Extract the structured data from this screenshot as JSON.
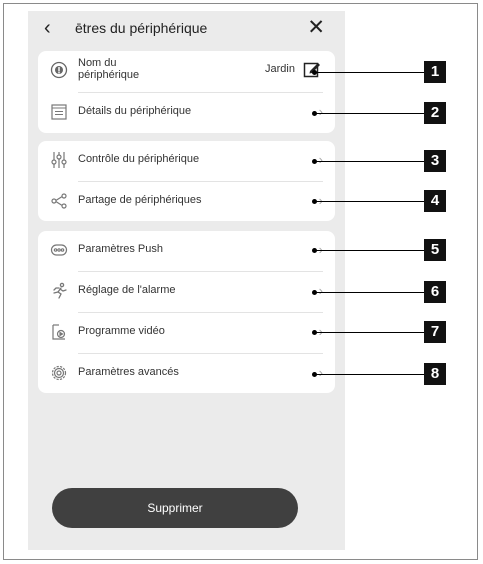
{
  "header": {
    "back_icon": "chevron-left-icon",
    "title": "ētres du périphérique",
    "close_icon": "close-icon"
  },
  "card1": {
    "name_label": "Nom du périphérique",
    "name_value": "Jardin",
    "details_label": "Détails du périphérique"
  },
  "card2": {
    "control_label": "Contrôle du périphérique",
    "share_label": "Partage de périphériques"
  },
  "card3": {
    "push_label": "Paramètres Push",
    "alarm_label": "Réglage de l'alarme",
    "video_label": "Programme vidéo",
    "advanced_label": "Paramètres avancés"
  },
  "delete_label": "Supprimer",
  "callouts": [
    "1",
    "2",
    "3",
    "4",
    "5",
    "6",
    "7",
    "8"
  ]
}
